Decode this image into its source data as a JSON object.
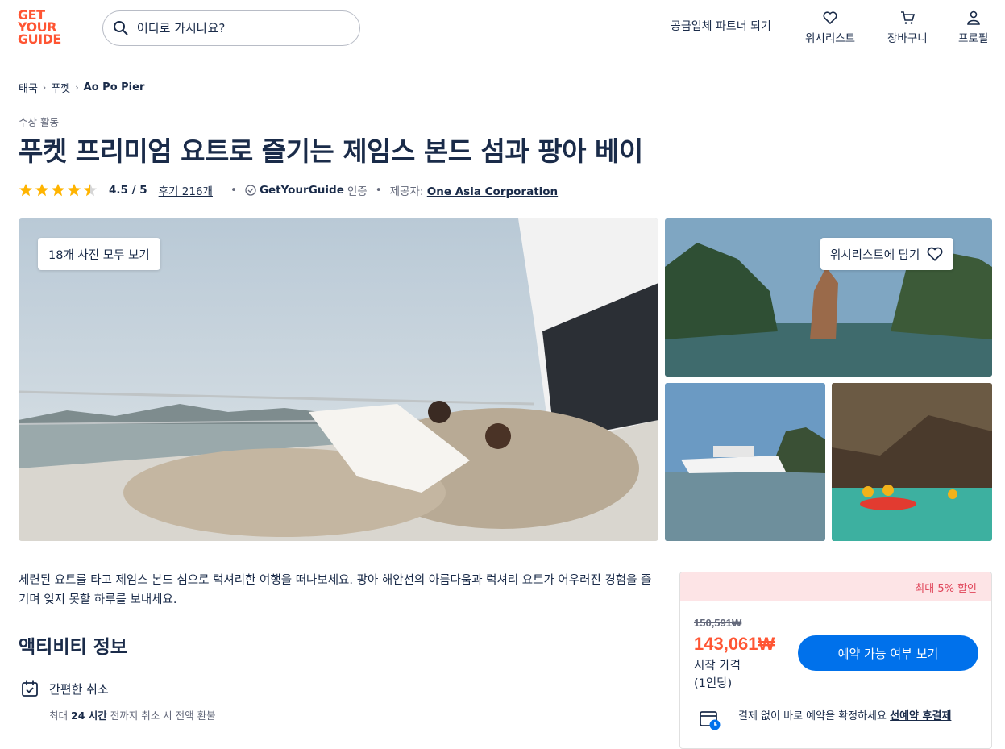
{
  "brand": {
    "logo_lines": [
      "GET",
      "YOUR",
      "GUIDE"
    ],
    "accent_color": "#ff5533",
    "primary_color": "#0071eb"
  },
  "header": {
    "search_placeholder": "어디로 가시나요?",
    "partner_link": "공급업체 파트너 되기",
    "nav": [
      {
        "label": "위시리스트",
        "icon": "heart-icon"
      },
      {
        "label": "장바구니",
        "icon": "cart-icon"
      },
      {
        "label": "프로필",
        "icon": "profile-icon"
      }
    ]
  },
  "breadcrumb": [
    "태국",
    "푸껫",
    "Ao Po Pier"
  ],
  "activity": {
    "category": "수상 활동",
    "title": "푸켓 프리미엄 요트로 즐기는 제임스 본드 섬과 팡아 베이",
    "rating": {
      "stars": 4.5,
      "score": "4.5 / 5",
      "reviews": "후기 216개"
    },
    "verified_brand": "GetYourGuide",
    "verified_suffix": "인증",
    "provider_label": "제공자:",
    "provider_name": "One Asia Corporation"
  },
  "gallery": {
    "all_photos": "18개 사진 모두 보기",
    "wishlist": "위시리스트에 담기"
  },
  "description": "세련된 요트를 타고 제임스 본드 섬으로 럭셔리한 여행을 떠나보세요. 팡아 해안선의 아름다움과 럭셔리 요트가 어우러진 경험을 즐기며 잊지 못할 하루를 보내세요.",
  "info": {
    "title": "액티비티 정보",
    "cancel_title": "간편한 취소",
    "cancel_pre": "최대",
    "cancel_bold": "24 시간",
    "cancel_post": "전까지 취소 시 전액 환불"
  },
  "booking": {
    "discount": "최대 5% 할인",
    "original_price": "150,591₩",
    "price": "143,061₩",
    "from_label": "시작 가격",
    "per_person": "(1인당)",
    "cta": "예약 가능 여부 보기",
    "reserve_text": "결제 없이 바로 예약을 확정하세요",
    "reserve_link": "선예약 후결제"
  }
}
